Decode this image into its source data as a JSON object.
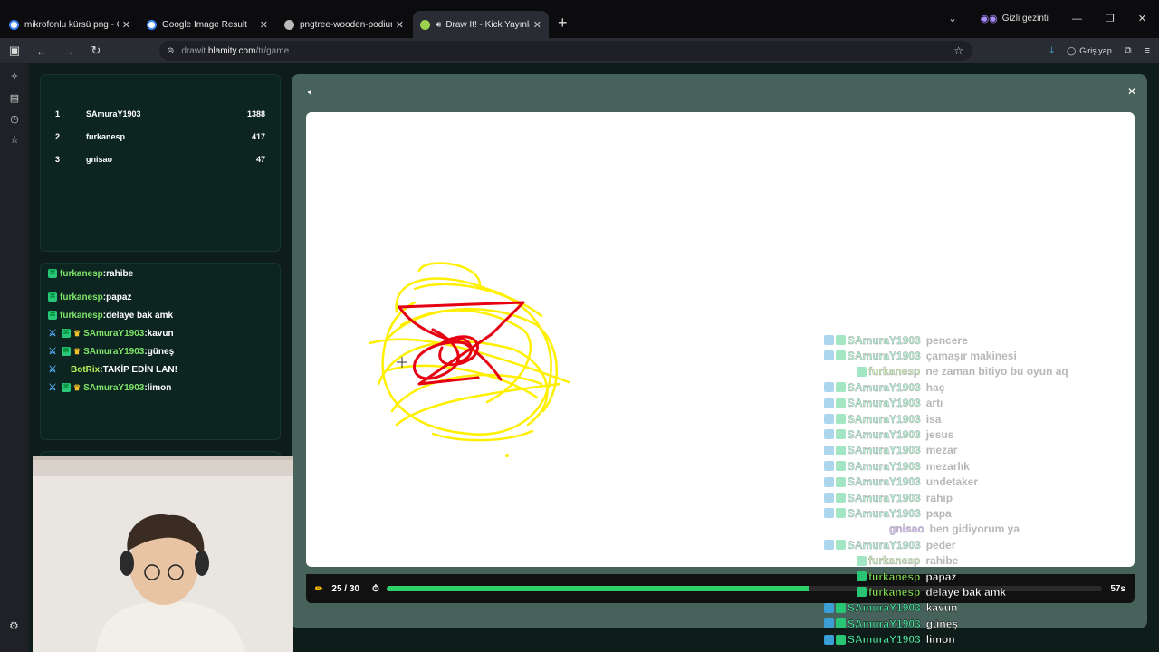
{
  "browser": {
    "tabs": [
      {
        "title": "mikrofonlu kürsü png - Google",
        "active": false,
        "favicon": "google-icon"
      },
      {
        "title": "Google Image Result",
        "active": false,
        "favicon": "google-icon"
      },
      {
        "title": "pngtree-wooden-podium-with-rain",
        "active": false,
        "favicon": "generic-icon"
      },
      {
        "title": "Draw It! - Kick Yayınları İçin",
        "active": true,
        "favicon": "drawit-icon"
      }
    ],
    "incognito_label": "Gizli gezinti",
    "url_prefix": "drawit.",
    "url_host": "blamity.com",
    "url_path": "/tr/game",
    "login_label": "Giriş yap"
  },
  "leaderboard": [
    {
      "rank": "1",
      "name": "SAmuraY1903",
      "score": "1388"
    },
    {
      "rank": "2",
      "name": "furkanesp",
      "score": "417"
    },
    {
      "rank": "3",
      "name": "gnisao",
      "score": "47"
    }
  ],
  "side_chat": [
    {
      "user": "furkanesp",
      "msg": "rahibe",
      "mod": false,
      "crown": false,
      "badge": true,
      "color": "green"
    },
    {
      "user": "furkanesp",
      "msg": "papaz",
      "mod": false,
      "crown": false,
      "badge": true,
      "color": "green"
    },
    {
      "user": "furkanesp",
      "msg": "delaye bak amk",
      "mod": false,
      "crown": false,
      "badge": true,
      "color": "green"
    },
    {
      "user": "SAmuraY1903",
      "msg": "kavun",
      "mod": true,
      "crown": true,
      "badge": true,
      "color": "green"
    },
    {
      "user": "SAmuraY1903",
      "msg": "güneş",
      "mod": true,
      "crown": true,
      "badge": true,
      "color": "green"
    },
    {
      "user": "BotRix",
      "msg": "TAKİP EDİN LAN!",
      "mod": true,
      "crown": false,
      "badge": false,
      "color": "lime"
    },
    {
      "user": "SAmuraY1903",
      "msg": "limon",
      "mod": true,
      "crown": true,
      "badge": true,
      "color": "green"
    }
  ],
  "game": {
    "round": "25 / 30",
    "time_left": "57s",
    "progress": 0.59
  },
  "overlay_chat": [
    {
      "user": "SAmuraY1903",
      "msg": "pencere",
      "faded": true
    },
    {
      "user": "SAmuraY1903",
      "msg": "çamaşır makinesi",
      "faded": true
    },
    {
      "user": "furkanesp",
      "msg": "ne zaman bitiyo bu oyun aq",
      "faded": true
    },
    {
      "user": "SAmuraY1903",
      "msg": "haç",
      "faded": true
    },
    {
      "user": "SAmuraY1903",
      "msg": "artı",
      "faded": true
    },
    {
      "user": "SAmuraY1903",
      "msg": "isa",
      "faded": true
    },
    {
      "user": "SAmuraY1903",
      "msg": "jesus",
      "faded": true
    },
    {
      "user": "SAmuraY1903",
      "msg": "mezar",
      "faded": true
    },
    {
      "user": "SAmuraY1903",
      "msg": "mezarlık",
      "faded": true
    },
    {
      "user": "SAmuraY1903",
      "msg": "undetaker",
      "faded": true
    },
    {
      "user": "SAmuraY1903",
      "msg": "rahip",
      "faded": true
    },
    {
      "user": "SAmuraY1903",
      "msg": "papa",
      "faded": true
    },
    {
      "user": "gnisao",
      "msg": "ben gidiyorum ya",
      "faded": true
    },
    {
      "user": "SAmuraY1903",
      "msg": "peder",
      "faded": true
    },
    {
      "user": "furkanesp",
      "msg": "rahibe",
      "faded": true
    },
    {
      "user": "furkanesp",
      "msg": "papaz",
      "faded": false
    },
    {
      "user": "furkanesp",
      "msg": "delaye bak amk",
      "faded": false
    },
    {
      "user": "SAmuraY1903",
      "msg": "kavun",
      "faded": false
    },
    {
      "user": "SAmuraY1903",
      "msg": "güneş",
      "faded": false
    },
    {
      "user": "SAmuraY1903",
      "msg": "limon",
      "faded": false
    }
  ],
  "colors": {
    "accent_green": "#2ed06a",
    "samura": "#4fe6a4",
    "furkan": "#8be55a",
    "gnisao": "#a45cf0",
    "drawing_yellow": "#ffef00",
    "drawing_red": "#e60012"
  }
}
